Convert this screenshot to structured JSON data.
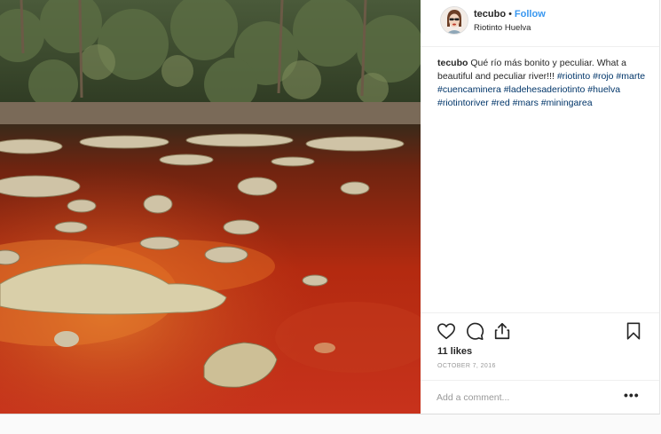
{
  "post": {
    "username": "tecubo",
    "separator": "•",
    "follow_label": "Follow",
    "location": "Riotinto Huelva",
    "caption_user": "tecubo",
    "caption_text": "Qué río más bonito y peculiar. What a beautiful and peculiar river!!!",
    "hashtags": [
      "#riotinto",
      "#rojo",
      "#marte",
      "#cuencaminera",
      "#ladehesaderiotinto",
      "#huelva",
      "#riotintoriver",
      "#red",
      "#mars",
      "#miningarea"
    ],
    "likes": "11 likes",
    "date": "OCTOBER 7, 2016",
    "comment_placeholder": "Add a comment...",
    "more_label": "•••"
  },
  "icons": {
    "like": "heart-icon",
    "comment": "comment-icon",
    "share": "share-icon",
    "save": "bookmark-icon",
    "options": "more-options-icon"
  },
  "colors": {
    "link": "#3897f0",
    "hashtag": "#003569",
    "river_red": "#b8250f",
    "river_orange": "#d9601a"
  }
}
